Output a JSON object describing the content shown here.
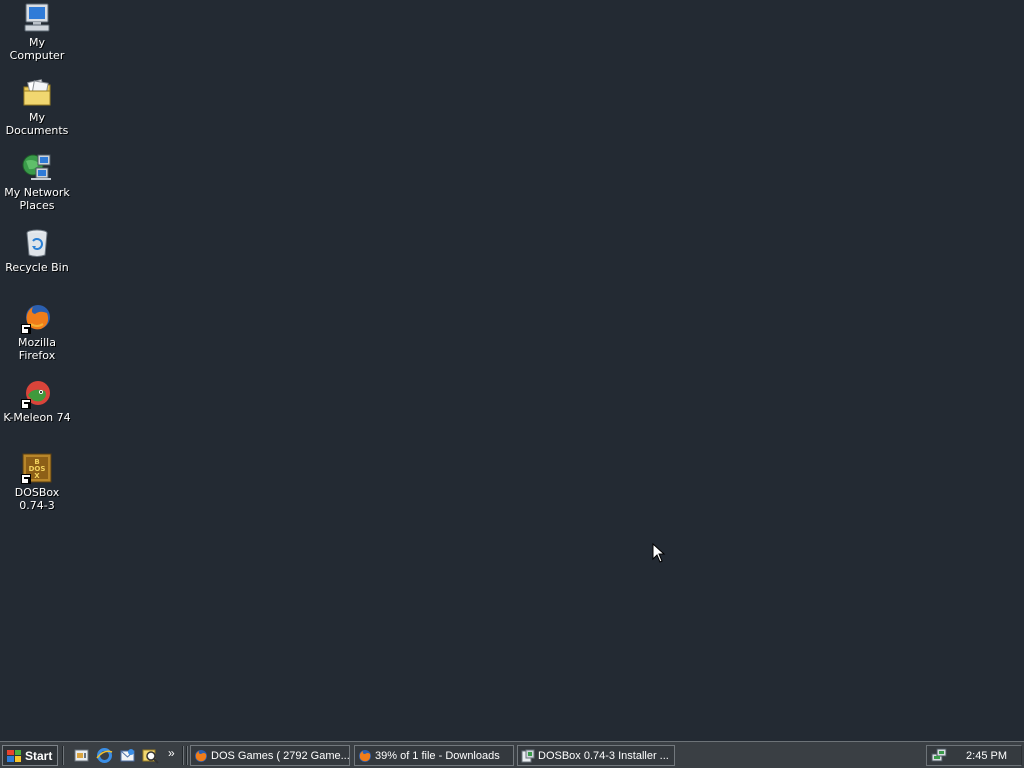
{
  "desktop": {
    "icons": [
      {
        "label": "My Computer"
      },
      {
        "label": "My Documents"
      },
      {
        "label": "My Network Places"
      },
      {
        "label": "Recycle Bin"
      },
      {
        "label": "Mozilla Firefox"
      },
      {
        "label": "K-Meleon 74"
      },
      {
        "label": "DOSBox 0.74-3"
      }
    ],
    "background_color": "#232a33"
  },
  "taskbar": {
    "start_label": "Start",
    "quick_launch": [
      {
        "icon": "show-desktop-icon"
      },
      {
        "icon": "internet-explorer-icon"
      },
      {
        "icon": "outlook-express-icon"
      },
      {
        "icon": "search-icon"
      }
    ],
    "overflow_label": "»",
    "tasks": [
      {
        "label": "DOS Games ( 2792 Game...",
        "icon": "firefox-icon"
      },
      {
        "label": "39% of 1 file - Downloads",
        "icon": "firefox-icon"
      },
      {
        "label": "DOSBox 0.74-3 Installer ...",
        "icon": "installer-icon"
      }
    ],
    "clock": "2:45 PM"
  }
}
